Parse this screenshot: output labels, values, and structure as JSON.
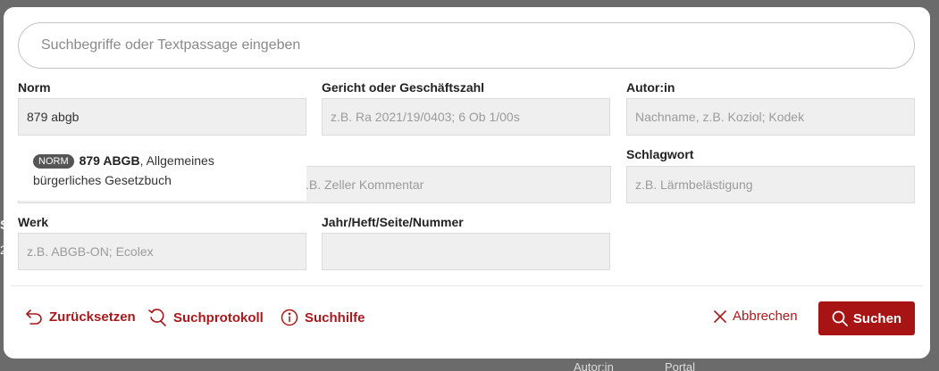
{
  "search": {
    "placeholder": "Suchbegriffe oder Textpassage eingeben"
  },
  "fields": {
    "norm": {
      "label": "Norm",
      "value": "879 abgb"
    },
    "gericht": {
      "label": "Gericht oder Geschäftszahl",
      "placeholder": "z.B. Ra 2021/19/0403; 6 Ob 1/00s"
    },
    "autor": {
      "label": "Autor:in",
      "placeholder": "Nachname, z.B. Koziol; Kodek"
    },
    "titel": {
      "placeholder": "z.B. Zeller Kommentar"
    },
    "schlagwort": {
      "label": "Schlagwort",
      "placeholder": "z.B. Lärmbelästigung"
    },
    "werk": {
      "label": "Werk",
      "placeholder": "z.B. ABGB-ON; Ecolex"
    },
    "jahr": {
      "label": "Jahr/Heft/Seite/Nummer",
      "placeholder": ""
    }
  },
  "autocomplete": {
    "badge": "NORM",
    "highlight": "879 ABGB",
    "rest_line1": ", Allgemeines",
    "line2": "bürgerliches Gesetzbuch"
  },
  "footer": {
    "reset": "Zurücksetzen",
    "history": "Suchprotokoll",
    "help": "Suchhilfe",
    "cancel": "Abbrechen",
    "search": "Suchen"
  },
  "background": {
    "frag_left1": "S",
    "frag_left2": "2",
    "frag_autor": "Autor:in",
    "frag_portal": "Portal"
  },
  "colors": {
    "accent": "#a81414",
    "overlay": "#6b6b6b"
  }
}
